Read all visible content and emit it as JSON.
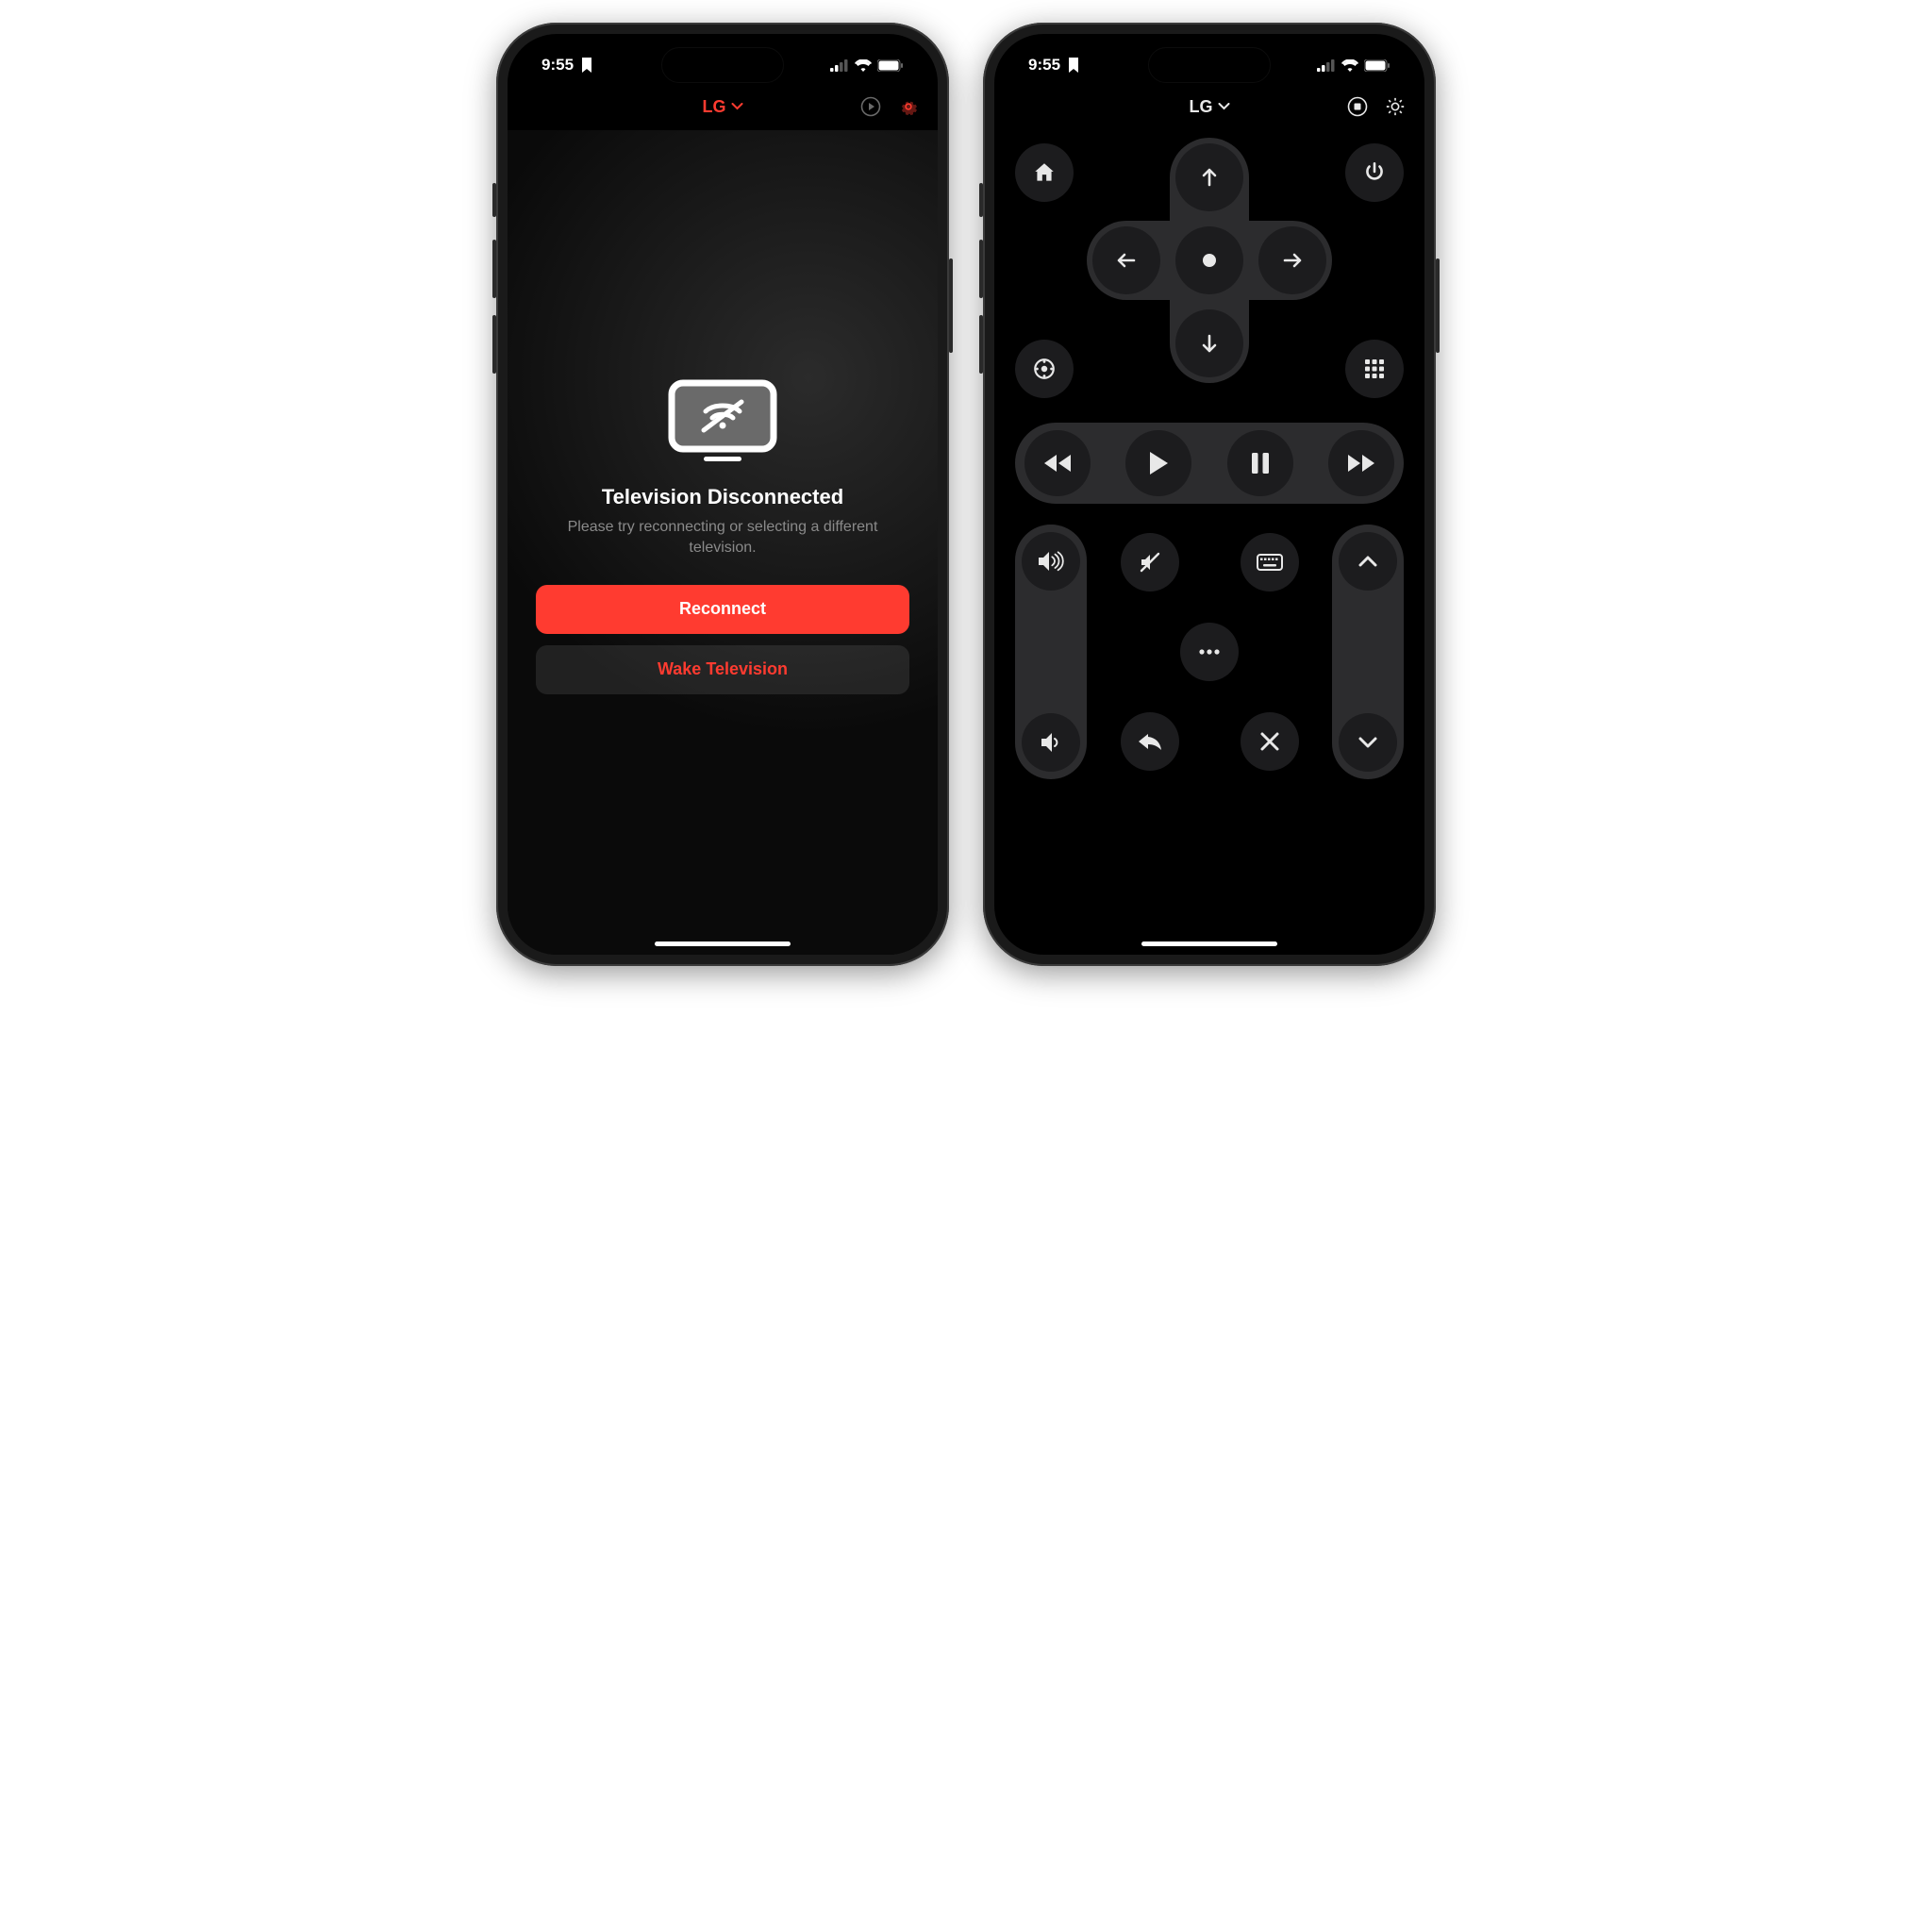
{
  "status": {
    "time": "9:55"
  },
  "phone_left": {
    "header": {
      "device_name": "LG"
    },
    "disconnected": {
      "title": "Television Disconnected",
      "subtitle": "Please try reconnecting or selecting a different television.",
      "reconnect": "Reconnect",
      "wake": "Wake Television"
    },
    "accent_color": "#ff3b30"
  },
  "phone_right": {
    "header": {
      "device_name": "LG"
    },
    "buttons": {
      "home": "home",
      "power": "power",
      "pointer": "pointer",
      "apps_grid": "apps",
      "up": "up",
      "down": "down",
      "left": "left",
      "right": "right",
      "ok": "ok",
      "rewind": "rewind",
      "play": "play",
      "pause": "pause",
      "forward": "forward",
      "vol_up": "volume-up",
      "vol_down": "volume-down",
      "mute": "mute",
      "keyboard": "keyboard",
      "more": "more",
      "back": "back",
      "exit": "exit",
      "ch_up": "channel-up",
      "ch_down": "channel-down"
    }
  }
}
